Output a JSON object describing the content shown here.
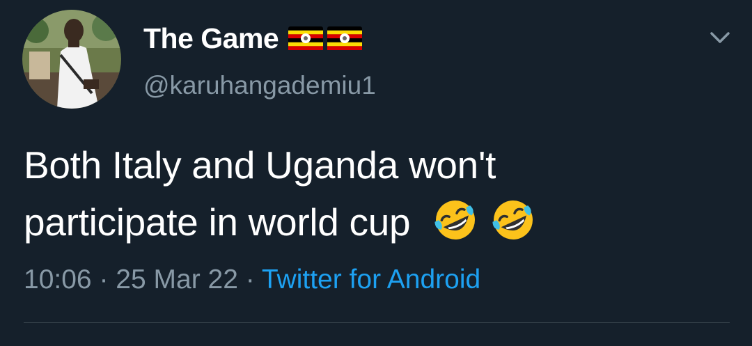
{
  "tweet": {
    "display_name": "The Game",
    "handle": "@karuhangademiu1",
    "text_line1": "Both Italy and Uganda won't",
    "text_line2": "participate in world cup",
    "time": "10:06",
    "separator": "·",
    "date": "25 Mar 22",
    "source": "Twitter for Android"
  },
  "icons": {
    "avatar": "user-avatar-photo",
    "flags": [
      "uganda-flag-icon",
      "uganda-flag-icon"
    ],
    "emojis": [
      "rolling-on-floor-laughing-emoji",
      "rolling-on-floor-laughing-emoji"
    ],
    "menu": "chevron-down-icon"
  },
  "colors": {
    "background": "#15202b",
    "primary_text": "#ffffff",
    "secondary_text": "#8899a6",
    "link": "#1da1f2",
    "divider": "#38444d"
  }
}
